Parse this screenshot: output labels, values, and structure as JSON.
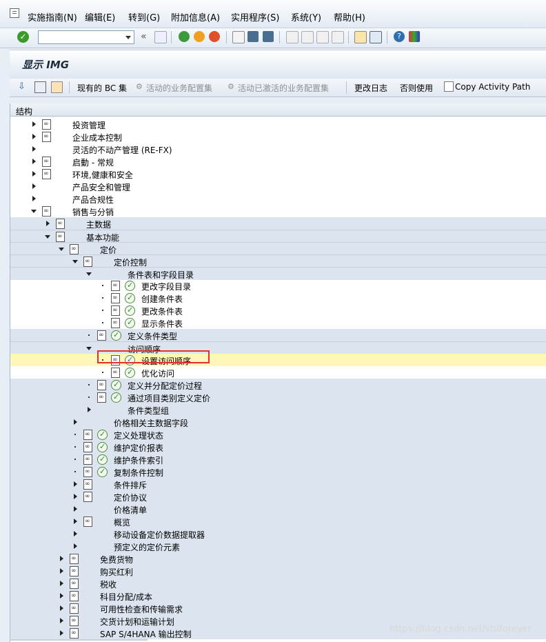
{
  "menu": [
    "实施指南(N)",
    "编辑(E)",
    "转到(G)",
    "附加信息(A)",
    "实用程序(S)",
    "系统(Y)",
    "帮助(H)"
  ],
  "window_title": "显示 IMG",
  "app_toolbar": {
    "bc_sets": "现有的 BC 集",
    "active_bc_sets": "活动的业务配置集",
    "activated_bc_sets": "活动已激活的业务配置集",
    "change_log": "更改日志",
    "release_notes": "否则使用",
    "copy_path": "Copy Activity Path"
  },
  "tree_header": "结构",
  "tree": [
    {
      "label": "投资管理",
      "level": 0,
      "state": "collapsed",
      "doc": true,
      "exec": false
    },
    {
      "label": "企业成本控制",
      "level": 0,
      "state": "collapsed",
      "doc": true,
      "exec": false
    },
    {
      "label": "灵活的不动产管理 (RE-FX)",
      "level": 0,
      "state": "collapsed",
      "doc": false,
      "exec": false
    },
    {
      "label": "启動 - 常规",
      "level": 0,
      "state": "collapsed",
      "doc": true,
      "exec": false
    },
    {
      "label": "环境,健康和安全",
      "level": 0,
      "state": "collapsed",
      "doc": true,
      "exec": false
    },
    {
      "label": "产品安全和管理",
      "level": 0,
      "state": "collapsed",
      "doc": false,
      "exec": false
    },
    {
      "label": "产品合规性",
      "level": 0,
      "state": "collapsed",
      "doc": false,
      "exec": false
    },
    {
      "label": "销售与分销",
      "level": 0,
      "state": "expanded",
      "doc": true,
      "exec": false
    },
    {
      "label": "主数据",
      "level": 1,
      "state": "collapsed",
      "doc": true,
      "exec": false
    },
    {
      "label": "基本功能",
      "level": 1,
      "state": "expanded",
      "doc": true,
      "exec": false
    },
    {
      "label": "定价",
      "level": 2,
      "state": "expanded",
      "doc": true,
      "exec": false
    },
    {
      "label": "定价控制",
      "level": 3,
      "state": "expanded",
      "doc": true,
      "exec": false
    },
    {
      "label": "条件表和字段目录",
      "level": 4,
      "state": "expanded",
      "doc": false,
      "exec": false
    },
    {
      "label": "更改字段目录",
      "level": 5,
      "state": "leaf",
      "doc": true,
      "exec": true
    },
    {
      "label": "创建条件表",
      "level": 5,
      "state": "leaf",
      "doc": true,
      "exec": true
    },
    {
      "label": "更改条件表",
      "level": 5,
      "state": "leaf",
      "doc": true,
      "exec": true
    },
    {
      "label": "显示条件表",
      "level": 5,
      "state": "leaf",
      "doc": true,
      "exec": true
    },
    {
      "label": "定义条件类型",
      "level": 4,
      "state": "leaf",
      "doc": true,
      "exec": true
    },
    {
      "label": "访问顺序",
      "level": 4,
      "state": "expanded",
      "doc": false,
      "exec": false
    },
    {
      "label": "设置访问顺序",
      "level": 5,
      "state": "leaf",
      "doc": true,
      "exec": true,
      "selected": true
    },
    {
      "label": "优化访问",
      "level": 5,
      "state": "leaf",
      "doc": true,
      "exec": true
    },
    {
      "label": "定义并分配定价过程",
      "level": 4,
      "state": "leaf",
      "doc": true,
      "exec": true
    },
    {
      "label": "通过项目类别定义定价",
      "level": 4,
      "state": "leaf",
      "doc": true,
      "exec": true
    },
    {
      "label": "条件类型组",
      "level": 4,
      "state": "collapsed",
      "doc": false,
      "exec": false
    },
    {
      "label": "价格相关主数据字段",
      "level": 3,
      "state": "collapsed",
      "doc": false,
      "exec": false
    },
    {
      "label": "定义处理状态",
      "level": 3,
      "state": "leaf",
      "doc": true,
      "exec": true
    },
    {
      "label": "维护定价报表",
      "level": 3,
      "state": "leaf",
      "doc": true,
      "exec": true
    },
    {
      "label": "维护条件索引",
      "level": 3,
      "state": "leaf",
      "doc": true,
      "exec": true
    },
    {
      "label": "复制条件控制",
      "level": 3,
      "state": "leaf",
      "doc": true,
      "exec": true
    },
    {
      "label": "条件排斥",
      "level": 3,
      "state": "collapsed",
      "doc": true,
      "exec": false
    },
    {
      "label": "定价协议",
      "level": 3,
      "state": "collapsed",
      "doc": true,
      "exec": false
    },
    {
      "label": "价格清单",
      "level": 3,
      "state": "collapsed",
      "doc": false,
      "exec": false
    },
    {
      "label": "概览",
      "level": 3,
      "state": "collapsed",
      "doc": true,
      "exec": false
    },
    {
      "label": "移动设备定价数据提取器",
      "level": 3,
      "state": "collapsed",
      "doc": false,
      "exec": false
    },
    {
      "label": "预定义的定价元素",
      "level": 3,
      "state": "collapsed",
      "doc": false,
      "exec": false
    },
    {
      "label": "免费货物",
      "level": 2,
      "state": "collapsed",
      "doc": true,
      "exec": false
    },
    {
      "label": "购买红利",
      "level": 2,
      "state": "collapsed",
      "doc": true,
      "exec": false
    },
    {
      "label": "税收",
      "level": 2,
      "state": "collapsed",
      "doc": true,
      "exec": false
    },
    {
      "label": "科目分配/成本",
      "level": 2,
      "state": "collapsed",
      "doc": true,
      "exec": false
    },
    {
      "label": "可用性检查和传输需求",
      "level": 2,
      "state": "collapsed",
      "doc": true,
      "exec": false
    },
    {
      "label": "交货计划和运输计划",
      "level": 2,
      "state": "collapsed",
      "doc": true,
      "exec": false
    },
    {
      "label": "SAP S/4HANA 输出控制",
      "level": 2,
      "state": "collapsed",
      "doc": true,
      "exec": false
    }
  ],
  "watermark": "https://blog.csdn.net/stuforever"
}
